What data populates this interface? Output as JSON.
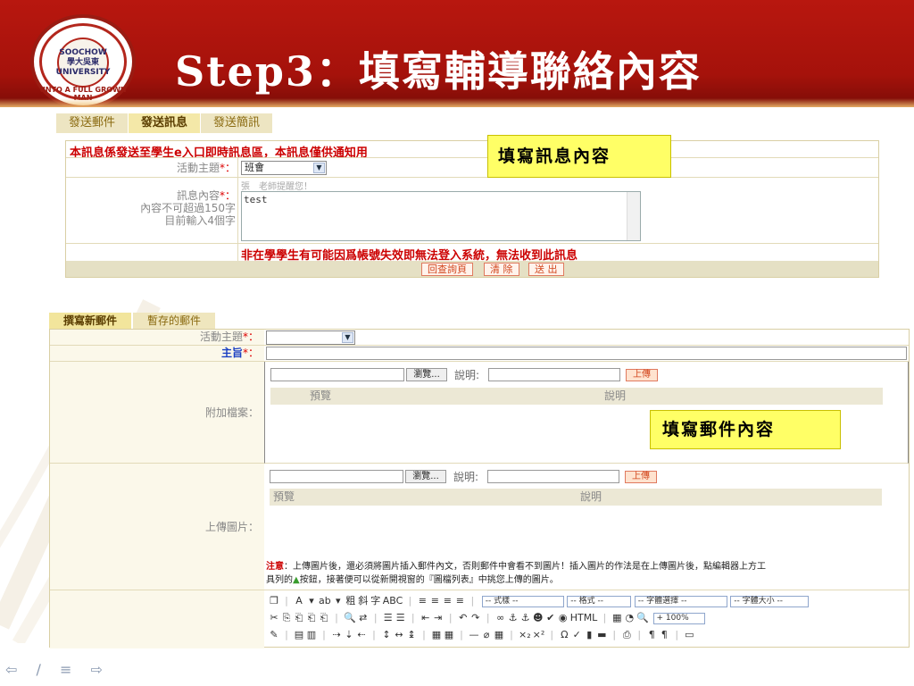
{
  "slide": {
    "title": "Step3：填寫輔導聯絡內容",
    "logo_text": [
      "SOOCHOW",
      "學大吳東",
      "UNIVERSITY"
    ],
    "logo_ring": "UNTO A FULL GROWN MAN"
  },
  "message_panel": {
    "tabs": [
      {
        "label": "發送郵件",
        "active": false
      },
      {
        "label": "發送訊息",
        "active": true
      },
      {
        "label": "發送簡訊",
        "active": false
      }
    ],
    "notice": "本訊息係發送至學生e入口即時訊息區，本訊息僅供通知用",
    "topic_label": "活動主題",
    "required_mark": "*：",
    "topic_value": "班會",
    "content_label": "訊息內容",
    "limit_label": "內容不可超過150字",
    "count_label": "目前輸入4個字",
    "greeting": "張　老師提醒您！",
    "message_value": "test",
    "warning": "非在學學生有可能因爲帳號失效即無法登入系統，無法收到此訊息",
    "buttons": {
      "back": "回查詢頁",
      "clear": "清 除",
      "send": "送 出"
    },
    "callout": "填寫訊息內容"
  },
  "mail_panel": {
    "tabs": [
      {
        "label": "撰寫新郵件",
        "active": true
      },
      {
        "label": "暫存的郵件",
        "active": false
      }
    ],
    "topic_label": "活動主題",
    "subject_label": "主旨",
    "required_mark": "*：",
    "attachment_label": "附加檔案：",
    "image_label": "上傳圖片：",
    "browse_label": "瀏覽...",
    "desc_label": "說明:",
    "upload_label": "上傳",
    "preview_header": "預覽",
    "desc_header": "說明",
    "callout": "填寫郵件內容",
    "note_prefix": "注意",
    "note_text": "：上傳圖片後，還必須將圖片插入郵件內文，否則郵件中會看不到圖片！插入圖片的作法是在上傳圖片後，點編輯器上方工",
    "note_text2_a": "具列的",
    "note_text2_b": "按鈕，接著便可以從新開視窗的『圖檔列表』中挑您上傳的圖片。",
    "toolbar": {
      "row1": [
        "❐",
        "|",
        "A",
        "▾",
        "ab",
        "▾",
        "粗",
        "斜",
        "字",
        "ABC",
        "|",
        "≡",
        "≡",
        "≡",
        "≡",
        "|"
      ],
      "style_dd": "-- 式樣 --",
      "format_dd": "-- 格式 --",
      "font_dd": "-- 字體選擇 --",
      "size_dd": "-- 字體大小 --",
      "row2": [
        "✂",
        "⎘",
        "⎗",
        "⎗",
        "⎗",
        "|",
        "🔍",
        "⇄",
        "|",
        "☰",
        "☰",
        "|",
        "⇤",
        "⇥",
        "|",
        "↶",
        "↷",
        "|",
        "∞",
        "⚓",
        "⚓",
        "☻",
        "✔",
        "◉",
        "HTML",
        "|",
        "▦",
        "◔",
        "🔍"
      ],
      "zoom": "+ 100%",
      "row3": [
        "✎",
        "|",
        "▤",
        "▥",
        "|",
        "⇢",
        "⇣",
        "⇠",
        "|",
        "↕",
        "↔",
        "↨",
        "|",
        "▦",
        "▦",
        "|",
        "—",
        "⌀",
        "▦",
        "|",
        "×₂",
        "×²",
        "|",
        "Ω",
        "✓",
        "▮",
        "▬",
        "|",
        "⎙",
        "|",
        "¶",
        "¶",
        "|",
        "▭"
      ]
    }
  },
  "nav": [
    "⇦",
    "∕",
    "≡",
    "⇨"
  ]
}
